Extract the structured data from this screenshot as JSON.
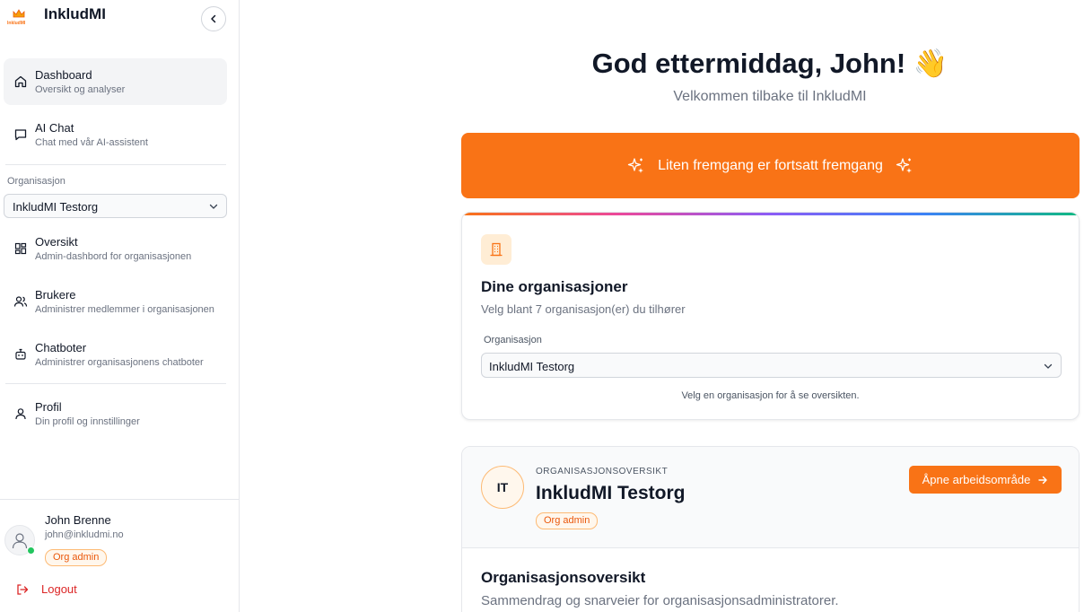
{
  "brand": {
    "name": "InkludMI",
    "logo_text": "InkludMI"
  },
  "sidebar": {
    "primary": [
      {
        "title": "Dashboard",
        "sub": "Oversikt og analyser",
        "icon": "home-icon"
      },
      {
        "title": "AI Chat",
        "sub": "Chat med vår AI-assistent",
        "icon": "chat-icon"
      }
    ],
    "org_label": "Organisasjon",
    "org_value": "InkludMI Testorg",
    "admin": [
      {
        "title": "Oversikt",
        "sub": "Admin-dashbord for organisasjonen",
        "icon": "grid-icon"
      },
      {
        "title": "Brukere",
        "sub": "Administrer medlemmer i organisasjonen",
        "icon": "users-icon"
      },
      {
        "title": "Chatboter",
        "sub": "Administrer organisasjonens chatboter",
        "icon": "bot-icon"
      }
    ],
    "profile": {
      "title": "Profil",
      "sub": "Din profil og innstillinger",
      "icon": "user-icon"
    },
    "user": {
      "name": "John Brenne",
      "email": "john@inkludmi.no",
      "role": "Org admin"
    },
    "logout": "Logout"
  },
  "main": {
    "greeting": "God ettermiddag, John! 👋",
    "welcome": "Velkommen tilbake til InkludMI",
    "banner": "Liten fremgang er fortsatt fremgang",
    "org_card": {
      "title": "Dine organisasjoner",
      "desc": "Velg blant 7 organisasjon(er) du tilhører",
      "select_label": "Organisasjon",
      "select_value": "InkludMI Testorg",
      "hint": "Velg en organisasjon for å se oversikten."
    },
    "overview_card": {
      "initials": "IT",
      "eyebrow": "ORGANISASJONSOVERSIKT",
      "name": "InkludMI Testorg",
      "role": "Org admin",
      "open_button": "Åpne arbeidsområde",
      "section_title": "Organisasjonsoversikt",
      "section_desc": "Sammendrag og snarveier for organisasjonsadministratorer."
    }
  },
  "colors": {
    "accent": "#f97316",
    "danger": "#dc2626",
    "success": "#22c55e"
  }
}
